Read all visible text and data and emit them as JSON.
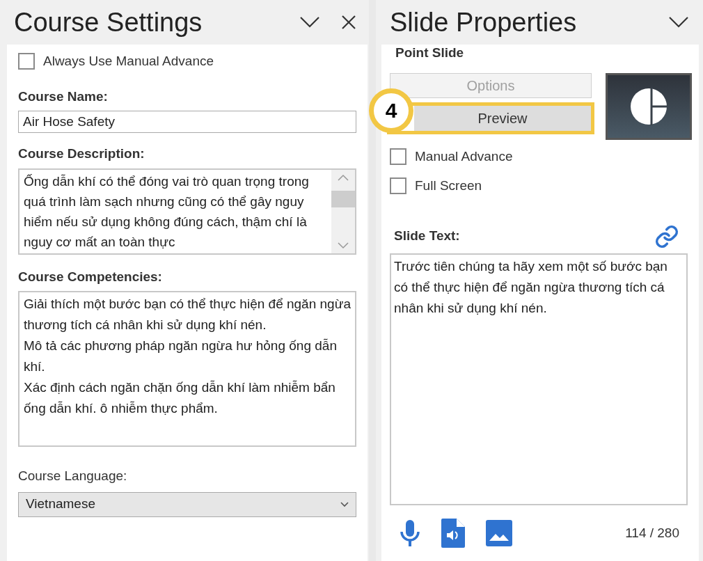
{
  "course_settings": {
    "title": "Course Settings",
    "always_manual_advance": {
      "label": "Always Use Manual Advance",
      "checked": false
    },
    "course_name": {
      "label": "Course Name:",
      "value": "Air Hose Safety"
    },
    "course_description": {
      "label": "Course Description:",
      "value": "Ống dẫn khí có thể đóng vai trò quan trọng trong quá trình làm sạch nhưng cũng có thể gây nguy hiểm nếu sử dụng không đúng cách, thậm chí là nguy cơ mất an toàn thực"
    },
    "course_competencies": {
      "label": "Course Competencies:",
      "lines": [
        "Giải thích một bước bạn có thể thực hiện để ngăn ngừa thương tích cá nhân khi sử dụng khí nén.",
        "Mô tả các phương pháp ngăn ngừa hư hỏng ống dẫn khí.",
        "Xác định cách ngăn chặn ống dẫn khí làm nhiễm bẩn ống dẫn khí. ô nhiễm thực phẩm."
      ]
    },
    "course_language": {
      "label": "Course Language:",
      "value": "Vietnamese"
    }
  },
  "slide_properties": {
    "title": "Slide Properties",
    "slide_type": "Point Slide",
    "buttons": [
      {
        "label": "Options",
        "disabled": true,
        "highlighted": false
      },
      {
        "label": "Preview",
        "disabled": false,
        "highlighted": true
      }
    ],
    "callout": "4",
    "checkboxes": [
      {
        "label": "Manual Advance",
        "checked": false
      },
      {
        "label": "Full Screen",
        "checked": false
      }
    ],
    "slide_text": {
      "label": "Slide Text:",
      "value": "Trước tiên chúng ta hãy xem một số bước bạn có thể thực hiện để ngăn ngừa thương tích cá nhân khi sử dụng khí nén."
    },
    "char_count": "114 / 280"
  }
}
